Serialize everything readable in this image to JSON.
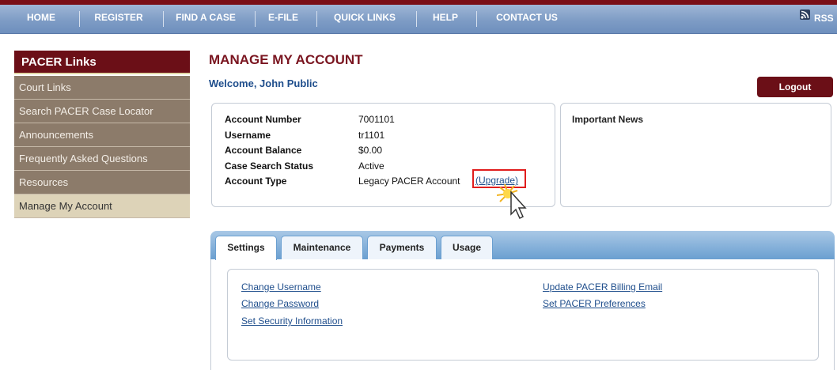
{
  "nav": {
    "items": [
      {
        "label": "HOME"
      },
      {
        "label": "REGISTER"
      },
      {
        "label": "FIND A CASE"
      },
      {
        "label": "E-FILE"
      },
      {
        "label": "QUICK LINKS"
      },
      {
        "label": "HELP"
      },
      {
        "label": "CONTACT US"
      }
    ],
    "rss_label": "RSS"
  },
  "sidebar": {
    "title": "PACER Links",
    "items": [
      {
        "label": "Court Links"
      },
      {
        "label": "Search PACER Case Locator"
      },
      {
        "label": "Announcements"
      },
      {
        "label": "Frequently Asked Questions"
      },
      {
        "label": "Resources"
      },
      {
        "label": "Manage My Account"
      }
    ]
  },
  "page": {
    "title": "MANAGE MY ACCOUNT",
    "welcome": "Welcome, John Public",
    "logout_label": "Logout"
  },
  "account": {
    "rows": [
      {
        "label": "Account Number",
        "value": "7001101"
      },
      {
        "label": "Username",
        "value": "tr1101"
      },
      {
        "label": "Account Balance",
        "value": "$0.00"
      },
      {
        "label": "Case Search Status",
        "value": "Active"
      },
      {
        "label": "Account Type",
        "value": "Legacy PACER Account"
      }
    ],
    "upgrade_label": "(Upgrade)"
  },
  "news": {
    "title": "Important News"
  },
  "tabs": [
    {
      "label": "Settings"
    },
    {
      "label": "Maintenance"
    },
    {
      "label": "Payments"
    },
    {
      "label": "Usage"
    }
  ],
  "settings_links": {
    "left": [
      {
        "label": "Change Username"
      },
      {
        "label": "Change Password"
      },
      {
        "label": "Set Security Information"
      }
    ],
    "right": [
      {
        "label": "Update PACER Billing Email"
      },
      {
        "label": "Set PACER Preferences"
      }
    ]
  },
  "colors": {
    "brand_maroon": "#6b0f17",
    "nav_blue": "#7e9cc5",
    "link_blue": "#1f4e8c",
    "highlight_red": "#e01d1d"
  }
}
